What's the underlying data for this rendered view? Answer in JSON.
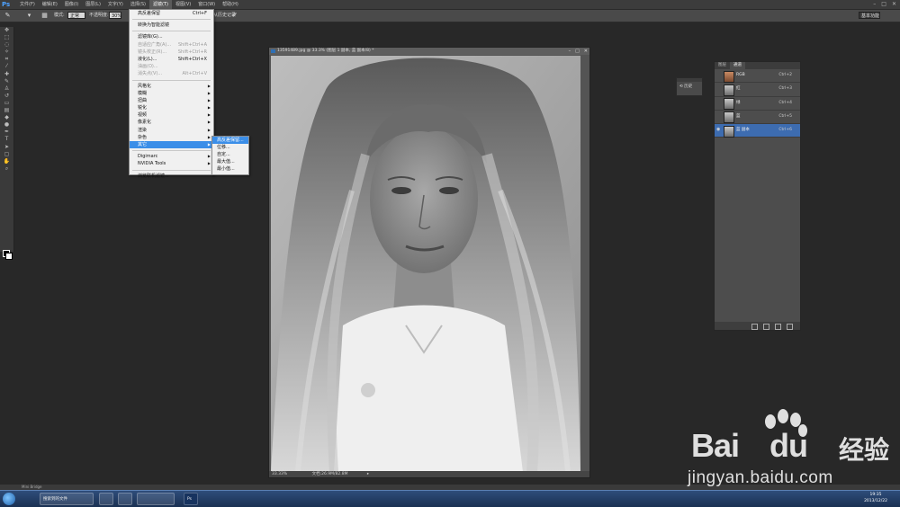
{
  "app": {
    "logo": "Ps",
    "window_buttons": [
      "–",
      "□",
      "✕"
    ]
  },
  "menubar": {
    "items": [
      "文件(F)",
      "编辑(E)",
      "图像(I)",
      "图层(L)",
      "文字(Y)",
      "选择(S)",
      "滤镜(T)",
      "视图(V)",
      "窗口(W)",
      "帮助(H)"
    ],
    "active_index": 6
  },
  "options": {
    "mode_label": "模式:",
    "mode_value": "正常",
    "opacity_label": "不透明度:",
    "opacity_value": "30%",
    "workspace": "基本功能",
    "extra_label": "从历史记录"
  },
  "filter_menu": {
    "items": [
      {
        "label": "高反差保留",
        "shortcut": "Ctrl+F",
        "disabled": false
      },
      {
        "sep": true
      },
      {
        "label": "转换为智能滤镜",
        "disabled": false
      },
      {
        "sep": true
      },
      {
        "label": "滤镜库(G)...",
        "disabled": false
      },
      {
        "label": "自适应广角(A)...",
        "shortcut": "Shift+Ctrl+A",
        "disabled": true
      },
      {
        "label": "镜头校正(R)...",
        "shortcut": "Shift+Ctrl+R",
        "disabled": true
      },
      {
        "label": "液化(L)...",
        "shortcut": "Shift+Ctrl+X",
        "disabled": false
      },
      {
        "label": "油画(O)...",
        "disabled": true
      },
      {
        "label": "消失点(V)...",
        "shortcut": "Alt+Ctrl+V",
        "disabled": true
      },
      {
        "sep": true
      },
      {
        "label": "风格化",
        "submenu": true
      },
      {
        "label": "模糊",
        "submenu": true
      },
      {
        "label": "扭曲",
        "submenu": true
      },
      {
        "label": "锐化",
        "submenu": true
      },
      {
        "label": "视频",
        "submenu": true
      },
      {
        "label": "像素化",
        "submenu": true
      },
      {
        "label": "渲染",
        "submenu": true
      },
      {
        "label": "杂色",
        "submenu": true
      },
      {
        "label": "其它",
        "submenu": true,
        "highlight": true
      },
      {
        "sep": true
      },
      {
        "label": "Digimarc",
        "submenu": true
      },
      {
        "label": "NVIDIA Tools",
        "submenu": true
      },
      {
        "sep": true
      },
      {
        "label": "浏览联机滤镜...",
        "disabled": false
      }
    ]
  },
  "other_submenu": {
    "items": [
      "高反差保留...",
      "位移...",
      "自定...",
      "最大值...",
      "最小值..."
    ],
    "highlight_index": 0
  },
  "document": {
    "title": "13591489.jpg @ 33.3% (图层 1 副本, 蓝 副本/8) *",
    "zoom": "33.33%",
    "doc_info": "文档:26.9M/82.8M"
  },
  "history_panel": {
    "label": "历史"
  },
  "channels_panel": {
    "tabs": [
      "图层",
      "通道"
    ],
    "active_tab": 1,
    "channels": [
      {
        "name": "RGB",
        "shortcut": "Ctrl+2",
        "color_thumb": true,
        "selected": false
      },
      {
        "name": "红",
        "shortcut": "Ctrl+3",
        "color_thumb": false,
        "selected": false
      },
      {
        "name": "绿",
        "shortcut": "Ctrl+4",
        "color_thumb": false,
        "selected": false
      },
      {
        "name": "蓝",
        "shortcut": "Ctrl+5",
        "color_thumb": false,
        "selected": false
      },
      {
        "name": "蓝 副本",
        "shortcut": "Ctrl+6",
        "color_thumb": false,
        "selected": true
      }
    ]
  },
  "bottom_strip": {
    "label": "Mini Bridge"
  },
  "taskbar": {
    "tasks": [
      "搜索到的文件",
      "",
      "",
      "",
      "Ps"
    ],
    "time": "19:35",
    "date": "2013/12/22"
  },
  "watermark": {
    "brand": "Bai",
    "brand2": "du",
    "jingyan": "经验",
    "url": "jingyan.baidu.com"
  },
  "colors": {
    "accent": "#3b8ee8",
    "selected_channel": "#3d6cb0",
    "workspace_bg": "#282828"
  }
}
